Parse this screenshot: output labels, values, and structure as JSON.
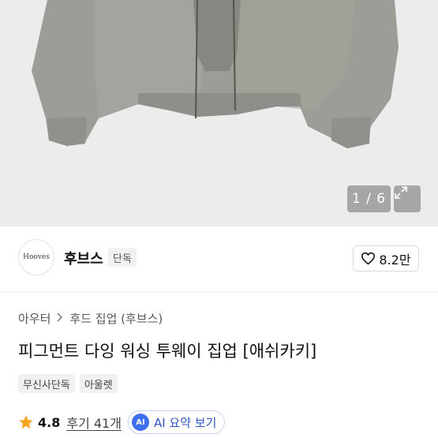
{
  "gallery": {
    "counter": "1 / 6",
    "expand_icon": "expand-icon"
  },
  "brand": {
    "logo_text": "Hooves",
    "name": "후브스",
    "badge": "단독",
    "like_icon": "heart-icon",
    "like_count": "8.2만"
  },
  "breadcrumb": {
    "items": [
      "아우터",
      "후드 집업 (후브스)"
    ],
    "separator_icon": "chevron-right-icon"
  },
  "product": {
    "title": "피그먼트 다잉 워싱 투웨이 집업 [애쉬카키]",
    "tags": [
      "무신사단독",
      "아울렛"
    ]
  },
  "review": {
    "star_icon": "star-icon",
    "star_color": "#f5a623",
    "rating": "4.8",
    "reviews_label": "후기 41개",
    "ai_badge": "AI",
    "ai_label": "AI 요약 보기"
  }
}
